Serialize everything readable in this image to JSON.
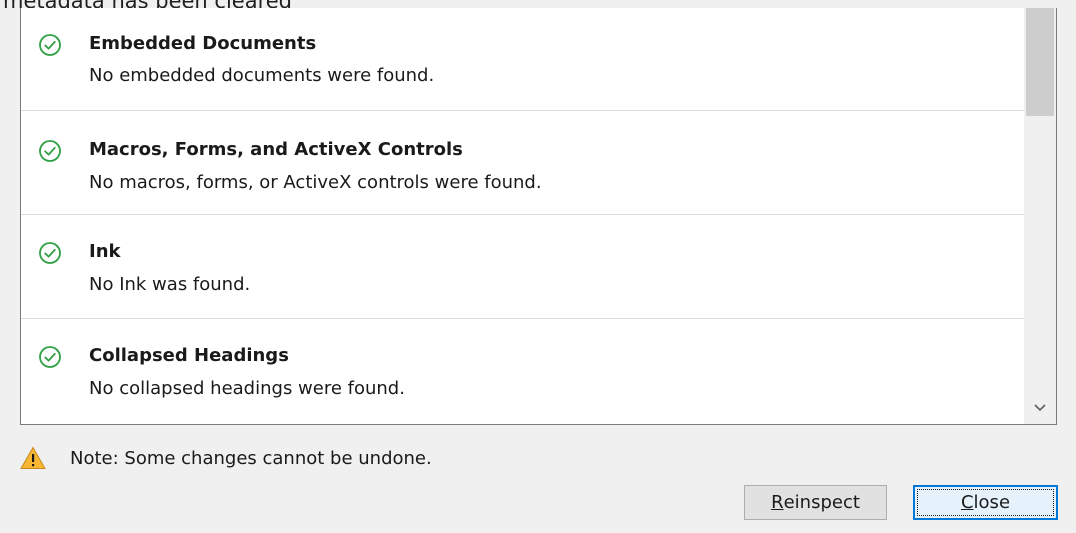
{
  "window": {
    "title_fragment": "metadata has been cleared"
  },
  "results": [
    {
      "title": "Embedded Documents",
      "description": "No embedded documents were found.",
      "status_icon": "check-circle-icon"
    },
    {
      "title": "Macros, Forms, and ActiveX Controls",
      "description": "No macros, forms, or ActiveX controls were found.",
      "status_icon": "check-circle-icon"
    },
    {
      "title": "Ink",
      "description": "No Ink was found.",
      "status_icon": "check-circle-icon"
    },
    {
      "title": "Collapsed Headings",
      "description": "No collapsed headings were found.",
      "status_icon": "check-circle-icon"
    }
  ],
  "note": {
    "icon": "warning-triangle-icon",
    "text": "Note: Some changes cannot be undone."
  },
  "buttons": {
    "reinspect": {
      "accel": "R",
      "rest": "einspect"
    },
    "close": {
      "accel": "C",
      "rest": "lose"
    }
  },
  "colors": {
    "check_green": "#2ea043",
    "warning_orange": "#f0a030",
    "focus_blue": "#0078d7"
  }
}
